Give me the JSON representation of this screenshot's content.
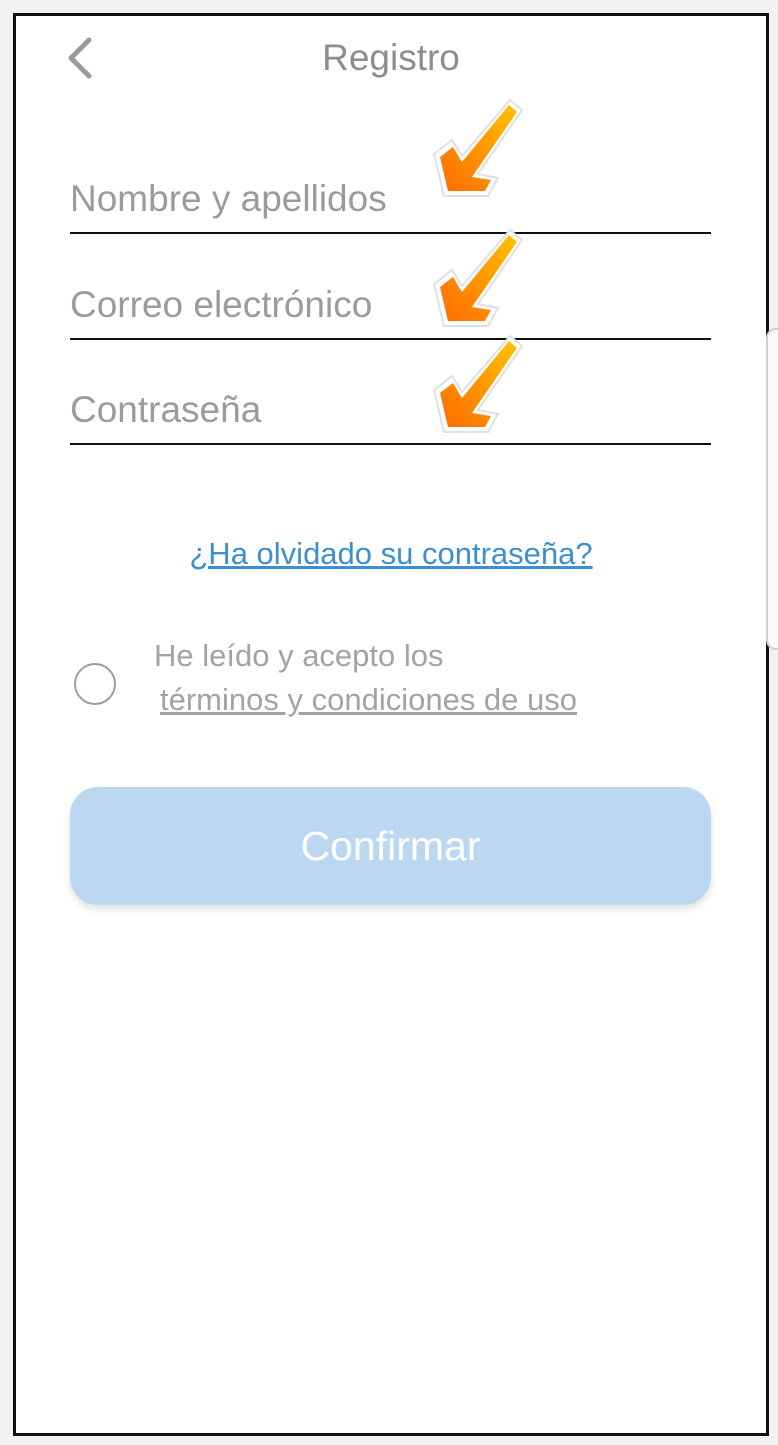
{
  "header": {
    "title": "Registro",
    "back_icon": "chevron-left-icon"
  },
  "form": {
    "name_placeholder": "Nombre y apellidos",
    "name_value": "",
    "email_placeholder": "Correo electrónico",
    "email_value": "",
    "password_placeholder": "Contraseña",
    "password_value": ""
  },
  "annotations": {
    "arrow_icon": "arrow-down-left-icon",
    "arrow_color": "#FF8A00"
  },
  "links": {
    "forgot_password": "¿Ha olvidado su contraseña?"
  },
  "terms": {
    "line1": "He leído y acepto los",
    "link": "términos y condiciones de uso",
    "checked": false
  },
  "actions": {
    "confirm_label": "Confirmar"
  },
  "colors": {
    "accent_link": "#3D8FCF",
    "confirm_bg": "#BCD8F1"
  }
}
